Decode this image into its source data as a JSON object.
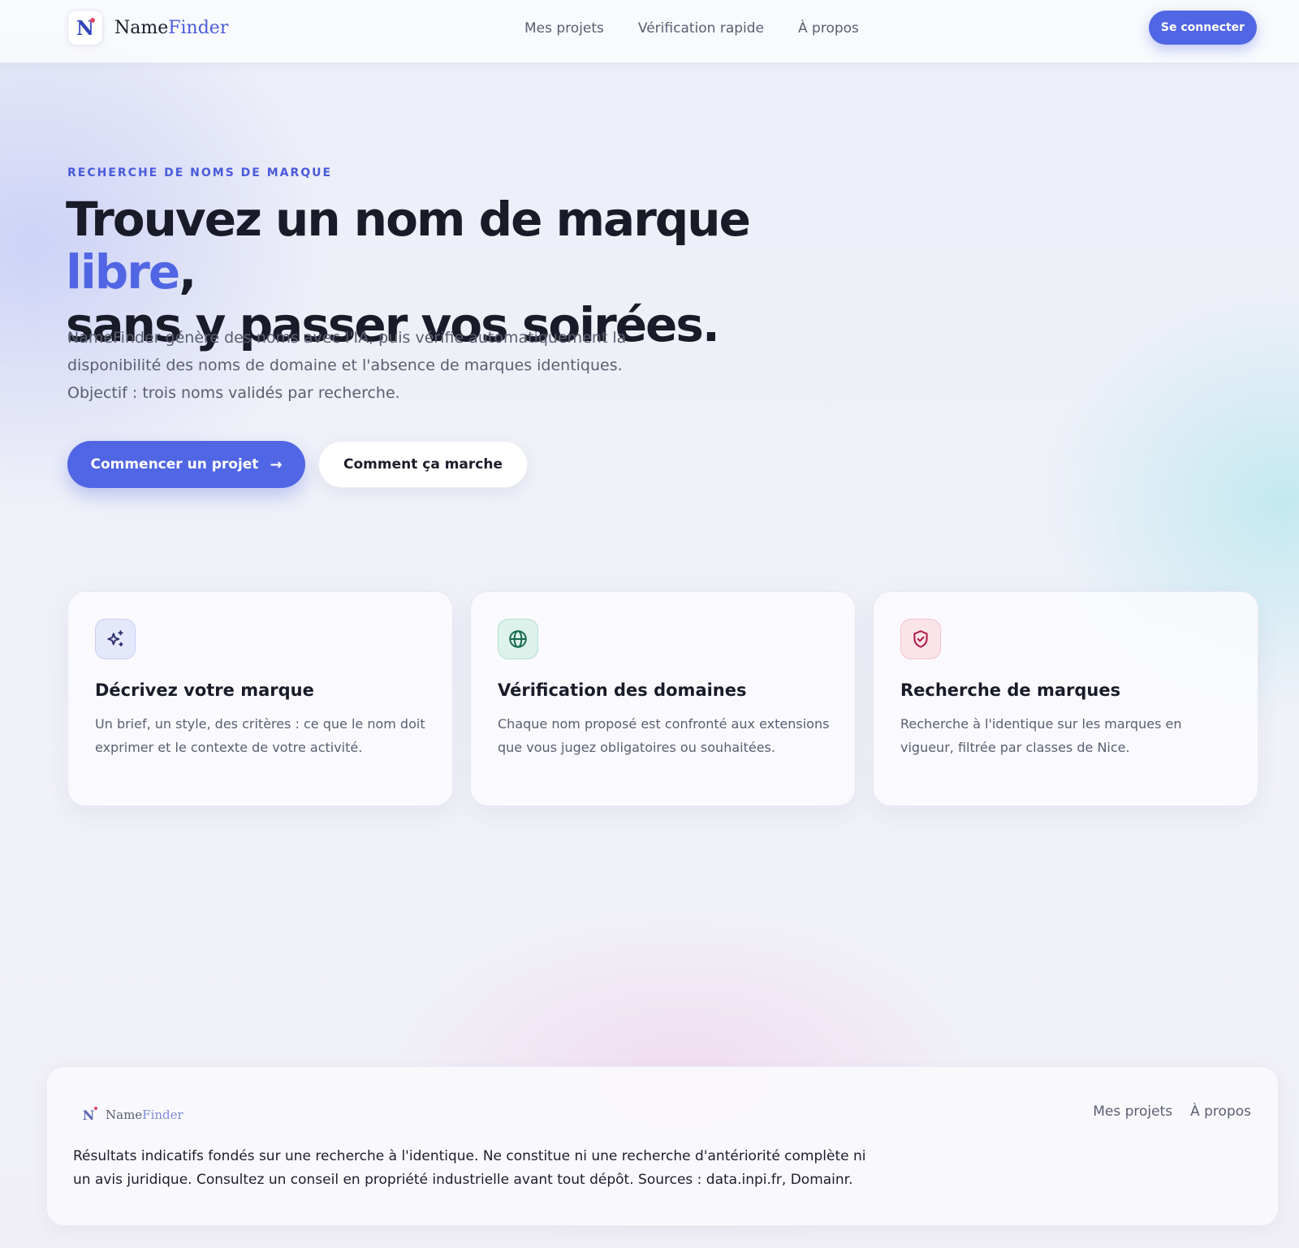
{
  "brand": {
    "initial": "N",
    "name_part1": "Name",
    "name_part2": "Finder"
  },
  "colors": {
    "accent": "#5166e4",
    "text": "#1a1b29",
    "muted": "#5a5e70",
    "dot": "#e0446a"
  },
  "nav": {
    "items": [
      "Mes projets",
      "Vérification rapide",
      "À propos"
    ]
  },
  "header": {
    "login_label": "Se connecter"
  },
  "hero": {
    "eyebrow": "RECHERCHE DE NOMS DE MARQUE",
    "headline_before": "Trouvez un nom de marque ",
    "headline_accent": "libre",
    "headline_after": ",",
    "headline_line2": "sans y passer vos soirées.",
    "lede": "NameFinder génère des noms avec l'IA, puis vérifie automatiquement la disponibilité des noms de domaine et l'absence de marques identiques. Objectif : trois noms validés par recherche.",
    "primary_label": "Commencer un projet",
    "primary_arrow": "→",
    "secondary_label": "Comment ça marche"
  },
  "features": [
    {
      "icon": "sparkles-icon",
      "title": "Décrivez votre marque",
      "text": "Un brief, un style, des critères : ce que le nom doit exprimer et le contexte de votre activité."
    },
    {
      "icon": "globe-icon",
      "title": "Vérification des domaines",
      "text": "Chaque nom proposé est confronté aux extensions que vous jugez obligatoires ou souhaitées."
    },
    {
      "icon": "shield-check-icon",
      "title": "Recherche de marques",
      "text": "Recherche à l'identique sur les marques en vigueur, filtrée par classes de Nice."
    }
  ],
  "footer": {
    "nav": [
      "Mes projets",
      "À propos"
    ],
    "disclaimer": "Résultats indicatifs fondés sur une recherche à l'identique. Ne constitue ni une recherche d'antériorité complète ni un avis juridique. Consultez un conseil en propriété industrielle avant tout dépôt. Sources : data.inpi.fr, Domainr."
  }
}
